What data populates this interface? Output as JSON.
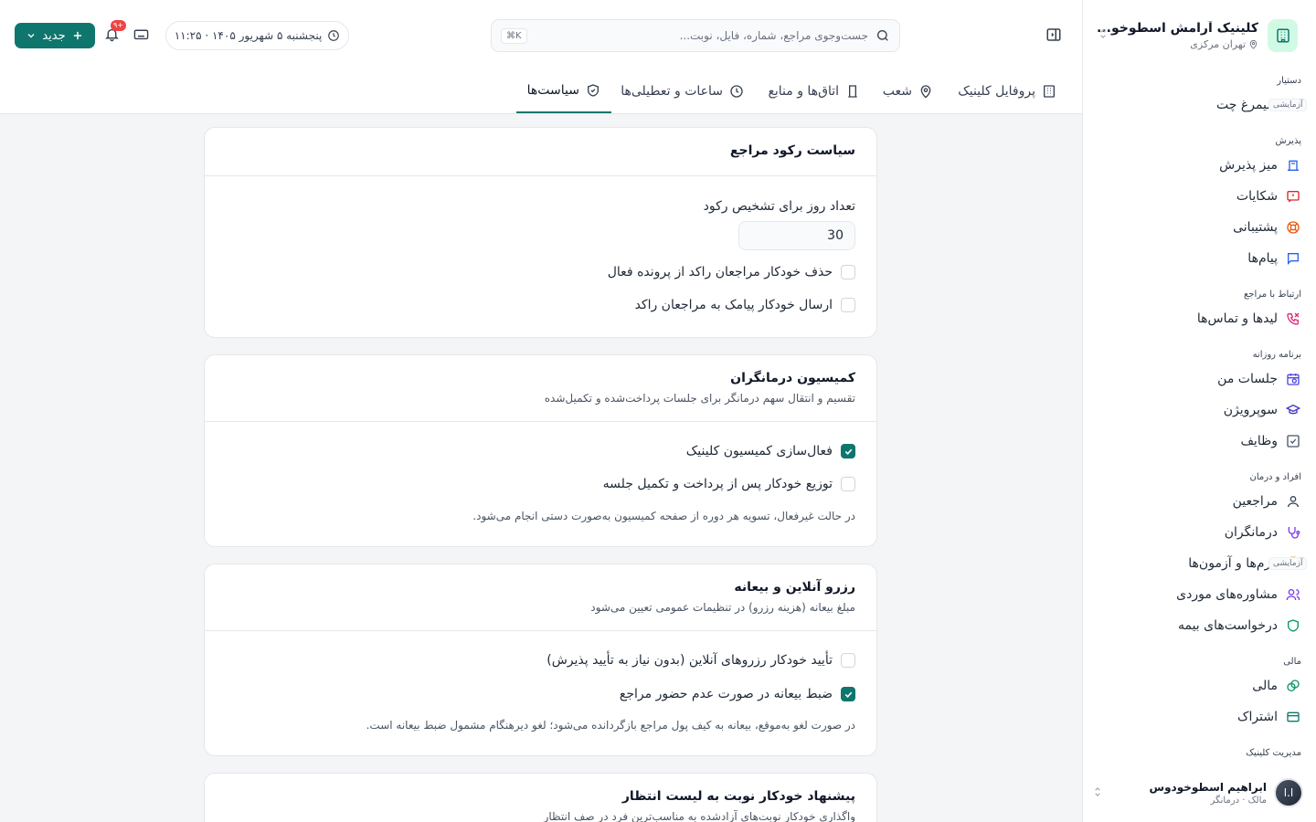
{
  "sidebar": {
    "clinic_name": "کلینیک آرامش اسطوخو...",
    "clinic_location": "تهران مرکزی",
    "experimental_badge": "آزمایشی",
    "groups": {
      "assistant": "دستیار",
      "reception": "پذیرش",
      "contact": "ارتباط با مراجع",
      "daily": "برنامه روزانه",
      "people": "افراد و درمان",
      "finance": "مالی",
      "management": "مدیریت کلینیک"
    },
    "items": {
      "simorgh": "سیمرغ چت",
      "desk": "میز پذیرش",
      "complaints": "شکایات",
      "support": "پشتیبانی",
      "messages": "پیام‌ها",
      "leads": "لیدها و تماس‌ها",
      "sessions": "جلسات من",
      "supervision": "سوپرویژن",
      "tasks": "وظایف",
      "clients": "مراجعین",
      "therapists": "درمانگران",
      "forms": "فرم‌ها و آزمون‌ها",
      "cases": "مشاوره‌های موردی",
      "insurance": "درخواست‌های بیمه",
      "finance": "مالی",
      "subscription": "اشتراک"
    },
    "user": {
      "name": "ابراهیم اسطوخودوس",
      "role": "مالک · درمانگر",
      "initials": "ا.ا"
    }
  },
  "topbar": {
    "search_placeholder": "جست‌وجوی مراجع، شماره، فایل، نوبت...",
    "search_shortcut": "⌘K",
    "date": "پنجشنبه ۵ شهریور ۱۴۰۵ · ۱۱:۲۵",
    "notif_count": "۹+",
    "new_button": "جدید"
  },
  "tabs": {
    "profile": "پروفایل کلینیک",
    "branches": "شعب",
    "rooms": "اتاق‌ها و منابع",
    "hours": "ساعات و تعطیلی‌ها",
    "policies": "سیاست‌ها"
  },
  "cards": {
    "stagnation": {
      "title": "سیاست رکود مراجع",
      "days_label": "تعداد روز برای تشخیص رکود",
      "days_value": "30",
      "opt1": "حذف خودکار مراجعان راکد از پرونده فعال",
      "opt1_checked": false,
      "opt2": "ارسال خودکار پیامک به مراجعان راکد",
      "opt2_checked": false
    },
    "commission": {
      "title": "کمیسیون درمانگران",
      "subtitle": "تقسیم و انتقال سهم درمانگر برای جلسات پرداخت‌شده و تکمیل‌شده",
      "opt1": "فعال‌سازی کمیسیون کلینیک",
      "opt1_checked": true,
      "opt2": "توزیع خودکار پس از پرداخت و تکمیل جلسه",
      "opt2_checked": false,
      "note": "در حالت غیرفعال، تسویه هر دوره از صفحه کمیسیون به‌صورت دستی انجام می‌شود."
    },
    "booking": {
      "title": "رزرو آنلاین و بیعانه",
      "subtitle": "مبلغ بیعانه (هزینه رزرو) در تنظیمات عمومی تعیین می‌شود",
      "opt1": "تأیید خودکار رزروهای آنلاین (بدون نیاز به تأیید پذیرش)",
      "opt1_checked": false,
      "opt2": "ضبط بیعانه در صورت عدم حضور مراجع",
      "opt2_checked": true,
      "note": "در صورت لغو به‌موقع، بیعانه به کیف پول مراجع بازگردانده می‌شود؛ لغو دیرهنگام مشمول ضبط بیعانه است."
    },
    "waitlist": {
      "title": "پیشنهاد خودکار نوبت به لیست انتظار",
      "subtitle": "واگذاری خودکار نوبت‌های آزادشده به مناسب‌ترین فرد در صف انتظار"
    }
  },
  "colors": {
    "accent": "#0f766e",
    "danger": "#ef4444"
  }
}
